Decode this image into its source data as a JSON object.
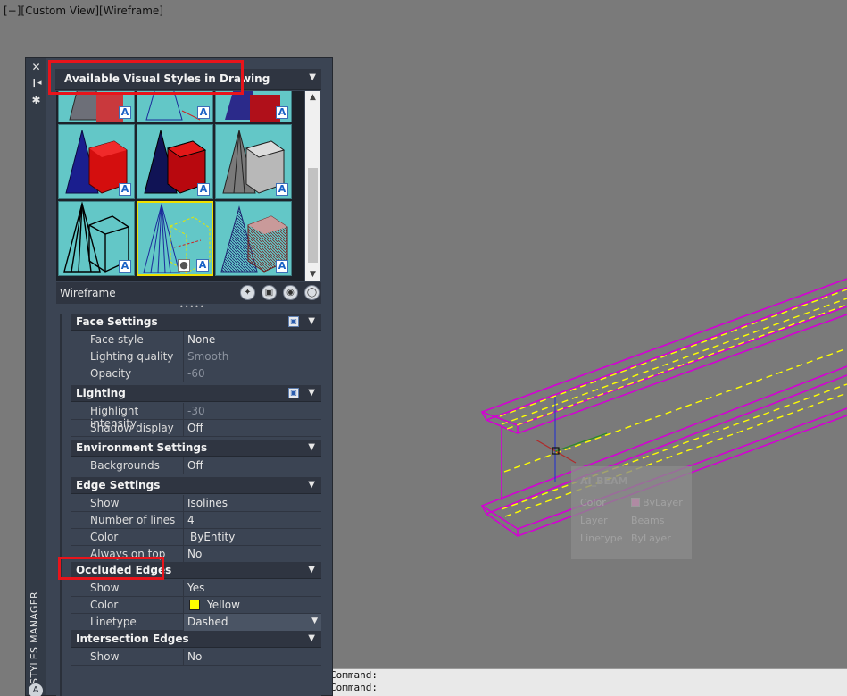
{
  "viewport": {
    "view_label": "[−][Custom View][Wireframe]",
    "background_color": "#7a7a7a",
    "beam_color": "#d400d4",
    "hidden_line_color": "#ffff00"
  },
  "command_line": {
    "lines": [
      "Command:",
      "Command:"
    ]
  },
  "palette": {
    "strip_title": "VISUAL STYLES MANAGER",
    "strip_buttons": {
      "close": "✕",
      "autohide": "❙◂",
      "properties": "✱"
    },
    "gallery_header": "Available Visual Styles in Drawing",
    "current_style_name": "Wireframe",
    "thumbnail_count": 12,
    "selected_thumbnail": "wireframe",
    "toolbar_icons": [
      "create-visual-style-icon",
      "apply-to-viewport-icon",
      "export-to-palette-icon",
      "delete-visual-style-icon"
    ],
    "sections": {
      "face_settings": {
        "title": "Face Settings",
        "rows": [
          {
            "name": "Face style",
            "value": "None"
          },
          {
            "name": "Lighting quality",
            "value": "Smooth"
          },
          {
            "name": "Opacity",
            "value": "-60"
          }
        ]
      },
      "lighting": {
        "title": "Lighting",
        "rows": [
          {
            "name": "Highlight intensity",
            "value": "-30"
          },
          {
            "name": "Shadow display",
            "value": "Off"
          }
        ]
      },
      "environment_settings": {
        "title": "Environment Settings",
        "rows": [
          {
            "name": "Backgrounds",
            "value": "Off"
          }
        ]
      },
      "edge_settings": {
        "title": "Edge Settings",
        "rows": [
          {
            "name": "Show",
            "value": "Isolines"
          },
          {
            "name": "Number of lines",
            "value": "4"
          },
          {
            "name": "Color",
            "value": "ByEntity"
          },
          {
            "name": "Always on top",
            "value": "No"
          }
        ]
      },
      "occluded_edges": {
        "title": "Occluded Edges",
        "rows": [
          {
            "name": "Show",
            "value": "Yes"
          },
          {
            "name": "Color",
            "value": "Yellow"
          },
          {
            "name": "Linetype",
            "value": "Dashed"
          }
        ]
      },
      "intersection_edges": {
        "title": "Intersection Edges",
        "rows": [
          {
            "name": "Show",
            "value": "No"
          }
        ]
      }
    }
  },
  "tooltip": {
    "title": "AI_BEAM",
    "rows": [
      {
        "key": "Color",
        "value": "ByLayer"
      },
      {
        "key": "Layer",
        "value": "Beams"
      },
      {
        "key": "Linetype",
        "value": "ByLayer"
      }
    ]
  }
}
